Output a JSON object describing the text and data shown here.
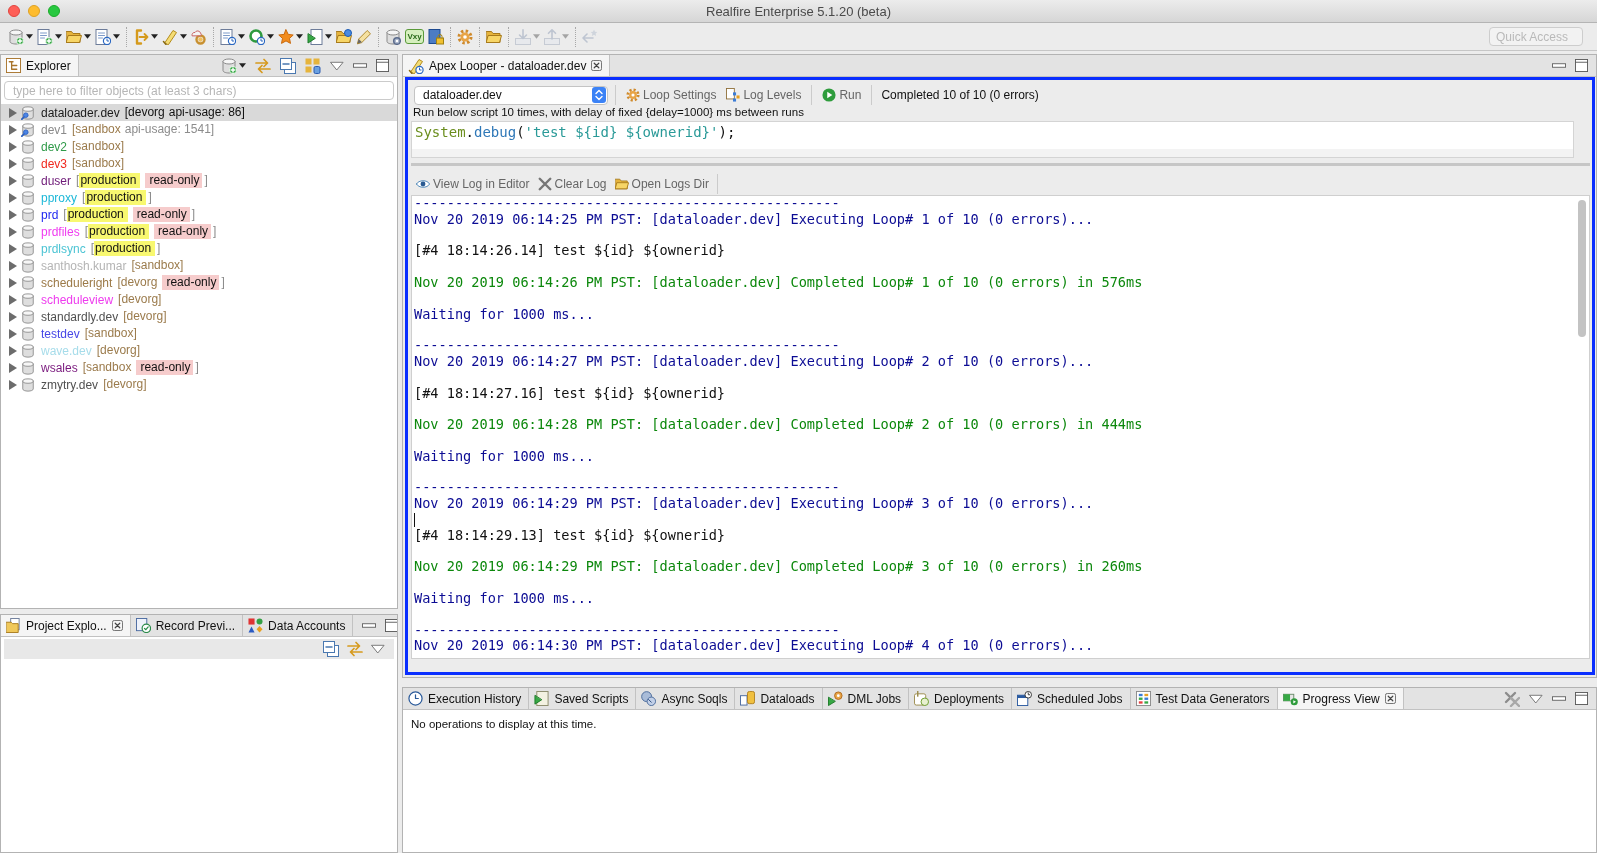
{
  "window": {
    "title": "Realfire Enterprise 5.1.20 (beta)"
  },
  "toolbar": {
    "groups": [
      [
        {
          "dropdown": true,
          "disabled": false
        },
        {
          "dropdown": true,
          "disabled": false
        },
        {
          "dropdown": true,
          "disabled": false
        },
        {
          "dropdown": true,
          "disabled": false
        }
      ],
      [
        {
          "dropdown": true,
          "disabled": false
        },
        {
          "dropdown": true,
          "disabled": false
        },
        {
          "dropdown": false,
          "disabled": false
        }
      ],
      [
        {
          "dropdown": true,
          "disabled": false
        },
        {
          "dropdown": true,
          "disabled": false
        },
        {
          "dropdown": true,
          "disabled": false
        },
        {
          "dropdown": true,
          "disabled": false
        },
        {
          "dropdown": false,
          "disabled": false
        },
        {
          "dropdown": false,
          "disabled": false
        }
      ],
      [
        {
          "dropdown": false,
          "disabled": false
        },
        {
          "dropdown": false,
          "disabled": false,
          "text": "Vxy"
        },
        {
          "dropdown": false,
          "disabled": false
        }
      ],
      [
        {
          "dropdown": false,
          "disabled": false
        }
      ],
      [
        {
          "dropdown": false,
          "disabled": false
        }
      ],
      [
        {
          "dropdown": true,
          "disabled": true
        },
        {
          "dropdown": true,
          "disabled": true
        }
      ],
      [
        {
          "dropdown": false,
          "disabled": true
        }
      ]
    ],
    "quick_access": {
      "placeholder": "Quick Access"
    }
  },
  "explorer": {
    "tab": {
      "label": "Explorer"
    },
    "filter": {
      "placeholder": "type here to filter objects (at least 3 chars)"
    },
    "orgs": [
      {
        "name": "dataloader.dev",
        "color": "#1a1a1a",
        "connected": true,
        "selected": true,
        "parts": [
          {
            "kind": "env",
            "text": "[devorg"
          },
          {
            "kind": "usage",
            "text": "api-usage: 86]"
          }
        ]
      },
      {
        "name": "dev1",
        "color": "#8a8a8a",
        "connected": true,
        "selected": false,
        "parts": [
          {
            "kind": "env",
            "text": "[sandbox"
          },
          {
            "kind": "usage",
            "text": "api-usage: 1541]"
          }
        ]
      },
      {
        "name": "dev2",
        "color": "#2e9a48",
        "connected": false,
        "selected": false,
        "parts": [
          {
            "kind": "env",
            "text": "[sandbox]"
          }
        ]
      },
      {
        "name": "dev3",
        "color": "#f0281e",
        "connected": false,
        "selected": false,
        "parts": [
          {
            "kind": "env",
            "text": "[sandbox]"
          }
        ]
      },
      {
        "name": "duser",
        "color": "#6e1a78",
        "connected": false,
        "selected": false,
        "parts": [
          {
            "kind": "bracket",
            "text": "["
          },
          {
            "kind": "production",
            "text": "production"
          },
          {
            "kind": "readonly",
            "text": "read-only"
          },
          {
            "kind": "bracket",
            "text": "]"
          }
        ]
      },
      {
        "name": "pproxy",
        "color": "#1cb8d8",
        "connected": false,
        "selected": false,
        "parts": [
          {
            "kind": "bracket",
            "text": "["
          },
          {
            "kind": "production",
            "text": "production"
          },
          {
            "kind": "bracket",
            "text": "]"
          }
        ]
      },
      {
        "name": "prd",
        "color": "#1e28f0",
        "connected": false,
        "selected": false,
        "parts": [
          {
            "kind": "bracket",
            "text": "["
          },
          {
            "kind": "production",
            "text": "production"
          },
          {
            "kind": "readonly",
            "text": "read-only"
          },
          {
            "kind": "bracket",
            "text": "]"
          }
        ]
      },
      {
        "name": "prdfiles",
        "color": "#f03cf0",
        "connected": false,
        "selected": false,
        "parts": [
          {
            "kind": "bracket",
            "text": "["
          },
          {
            "kind": "production",
            "text": "production"
          },
          {
            "kind": "readonly",
            "text": "read-only"
          },
          {
            "kind": "bracket",
            "text": "]"
          }
        ]
      },
      {
        "name": "prdlsync",
        "color": "#4cc4d4",
        "connected": false,
        "selected": false,
        "parts": [
          {
            "kind": "bracket",
            "text": "["
          },
          {
            "kind": "production",
            "text": "production"
          },
          {
            "kind": "bracket",
            "text": "]"
          }
        ]
      },
      {
        "name": "santhosh.kumar",
        "color": "#b4b4b4",
        "connected": false,
        "selected": false,
        "parts": [
          {
            "kind": "env",
            "text": "[sandbox]"
          }
        ]
      },
      {
        "name": "scheduleright",
        "color": "#9c7a48",
        "connected": false,
        "selected": false,
        "parts": [
          {
            "kind": "env",
            "text": "[devorg"
          },
          {
            "kind": "readonly",
            "text": "read-only"
          },
          {
            "kind": "bracket",
            "text": "]"
          }
        ]
      },
      {
        "name": "scheduleview",
        "color": "#ee3cee",
        "connected": false,
        "selected": false,
        "parts": [
          {
            "kind": "env",
            "text": "[devorg]"
          }
        ]
      },
      {
        "name": "standardly.dev",
        "color": "#505050",
        "connected": false,
        "selected": false,
        "parts": [
          {
            "kind": "env",
            "text": "[devorg]"
          }
        ]
      },
      {
        "name": "testdev",
        "color": "#4646e6",
        "connected": false,
        "selected": false,
        "parts": [
          {
            "kind": "env",
            "text": "[sandbox]"
          }
        ]
      },
      {
        "name": "wave.dev",
        "color": "#a6dcea",
        "connected": false,
        "selected": false,
        "parts": [
          {
            "kind": "env",
            "text": "[devorg]"
          }
        ]
      },
      {
        "name": "wsales",
        "color": "#7a1a7e",
        "connected": false,
        "selected": false,
        "parts": [
          {
            "kind": "env",
            "text": "[sandbox"
          },
          {
            "kind": "readonly",
            "text": "read-only"
          },
          {
            "kind": "bracket",
            "text": "]"
          }
        ]
      },
      {
        "name": "zmytry.dev",
        "color": "#505050",
        "connected": false,
        "selected": false,
        "parts": [
          {
            "kind": "env",
            "text": "[devorg]"
          }
        ]
      }
    ]
  },
  "lower_left": {
    "tabs": [
      {
        "label": "Project Explo...",
        "selected": true
      },
      {
        "label": "Record Previ...",
        "selected": false
      },
      {
        "label": "Data Accounts",
        "selected": false
      }
    ]
  },
  "editor": {
    "tab": {
      "label": "Apex Looper - dataloader.dev"
    },
    "org_select": {
      "value": "dataloader.dev"
    },
    "actions": [
      {
        "label": "Loop Settings"
      },
      {
        "label": "Log Levels"
      },
      {
        "label": "Run"
      }
    ],
    "status": "Completed 10 of 10 (0 errors)",
    "note": "Run below script 10 times, with delay of fixed {delay=1000} ms between runs",
    "script": [
      {
        "kind": "type",
        "text": "System"
      },
      {
        "kind": "punct",
        "text": "."
      },
      {
        "kind": "method",
        "text": "debug"
      },
      {
        "kind": "punct",
        "text": "("
      },
      {
        "kind": "string",
        "text": "'test ${id} ${ownerid}'"
      },
      {
        "kind": "punct",
        "text": ");"
      }
    ],
    "log_actions": [
      {
        "label": "View Log in Editor"
      },
      {
        "label": "Clear Log"
      },
      {
        "label": "Open Logs Dir"
      }
    ],
    "log": [
      {
        "kind": "separator",
        "text": "----------------------------------------------------",
        "cursor": false
      },
      {
        "kind": "executing",
        "text": "Nov 20 2019 06:14:25 PM PST: [dataloader.dev] Executing Loop# 1 of 10 (0 errors)...",
        "cursor": false
      },
      {
        "kind": "output",
        "text": "[#4 18:14:26.14] test ${id} ${ownerid}",
        "cursor": false
      },
      {
        "kind": "completed",
        "text": "Nov 20 2019 06:14:26 PM PST: [dataloader.dev] Completed Loop# 1 of 10 (0 errors) in 576ms",
        "cursor": false
      },
      {
        "kind": "waiting",
        "text": "Waiting for 1000 ms...",
        "cursor": false
      },
      {
        "kind": "separator",
        "text": "----------------------------------------------------",
        "cursor": false
      },
      {
        "kind": "executing",
        "text": "Nov 20 2019 06:14:27 PM PST: [dataloader.dev] Executing Loop# 2 of 10 (0 errors)...",
        "cursor": false
      },
      {
        "kind": "output",
        "text": "[#4 18:14:27.16] test ${id} ${ownerid}",
        "cursor": false
      },
      {
        "kind": "completed",
        "text": "Nov 20 2019 06:14:28 PM PST: [dataloader.dev] Completed Loop# 2 of 10 (0 errors) in 444ms",
        "cursor": false
      },
      {
        "kind": "waiting",
        "text": "Waiting for 1000 ms...",
        "cursor": false
      },
      {
        "kind": "separator",
        "text": "----------------------------------------------------",
        "cursor": false
      },
      {
        "kind": "executing",
        "text": "Nov 20 2019 06:14:29 PM PST: [dataloader.dev] Executing Loop# 3 of 10 (0 errors)...",
        "cursor": true
      },
      {
        "kind": "output",
        "text": "[#4 18:14:29.13] test ${id} ${ownerid}",
        "cursor": false
      },
      {
        "kind": "completed",
        "text": "Nov 20 2019 06:14:29 PM PST: [dataloader.dev] Completed Loop# 3 of 10 (0 errors) in 260ms",
        "cursor": false
      },
      {
        "kind": "waiting",
        "text": "Waiting for 1000 ms...",
        "cursor": false
      },
      {
        "kind": "separator",
        "text": "----------------------------------------------------",
        "cursor": false
      },
      {
        "kind": "executing",
        "text": "Nov 20 2019 06:14:30 PM PST: [dataloader.dev] Executing Loop# 4 of 10 (0 errors)...",
        "cursor": false
      }
    ]
  },
  "bottom": {
    "tabs": [
      {
        "label": "Execution History",
        "selected": false
      },
      {
        "label": "Saved Scripts",
        "selected": false
      },
      {
        "label": "Async Soqls",
        "selected": false
      },
      {
        "label": "Dataloads",
        "selected": false
      },
      {
        "label": "DML Jobs",
        "selected": false
      },
      {
        "label": "Deployments",
        "selected": false
      },
      {
        "label": "Scheduled Jobs",
        "selected": false
      },
      {
        "label": "Test Data Generators",
        "selected": false
      },
      {
        "label": "Progress View",
        "selected": true
      }
    ],
    "message": "No operations to display at this time."
  }
}
